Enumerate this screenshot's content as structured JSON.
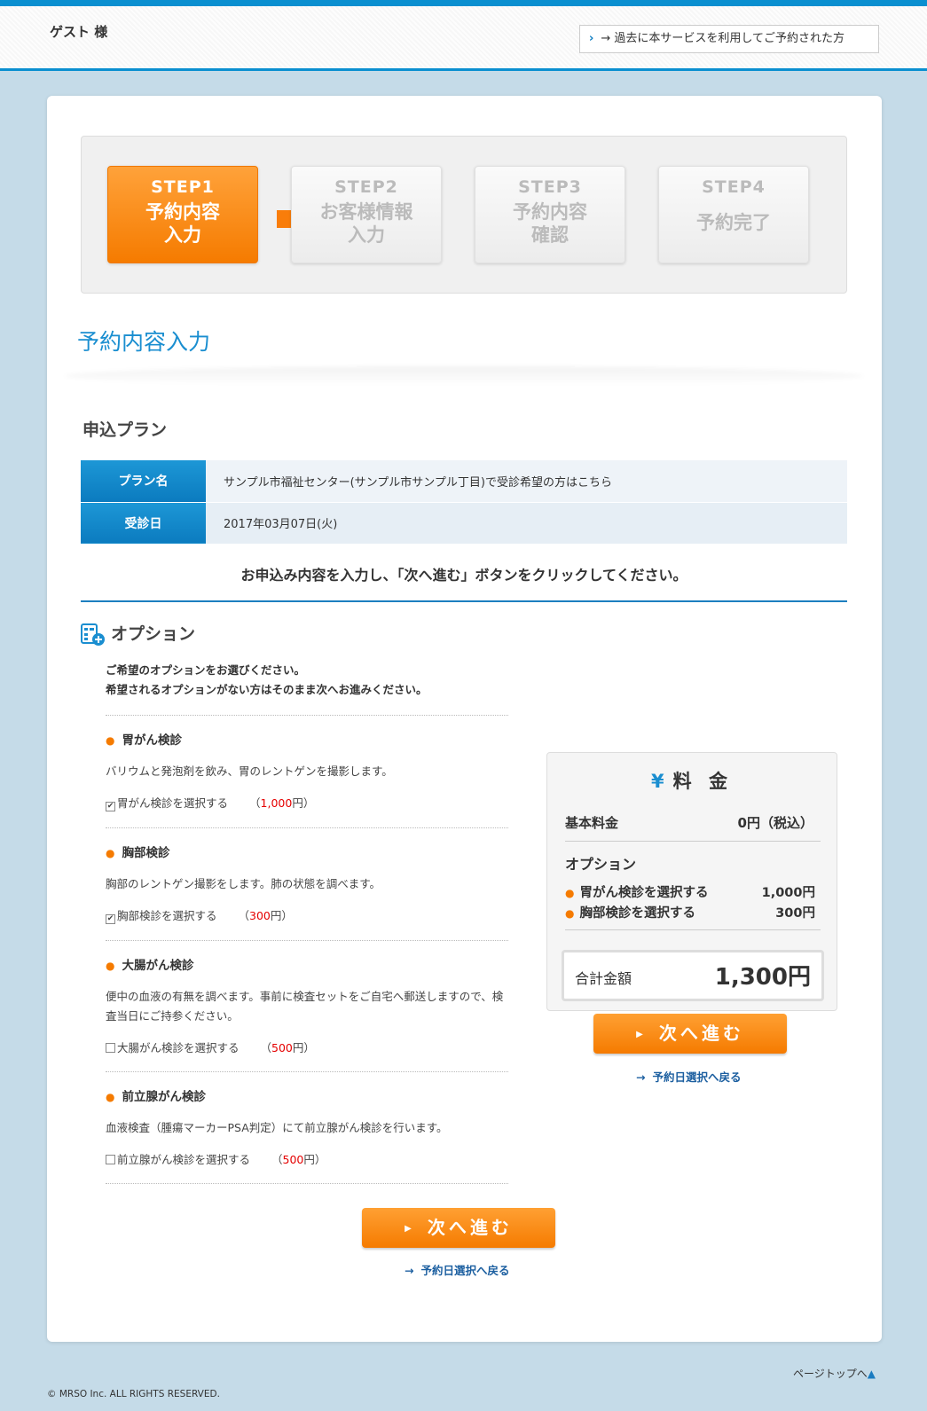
{
  "header": {
    "guest": "ゲスト 様",
    "past_link": "→ 過去に本サービスを利用してご予約された方"
  },
  "steps": [
    {
      "num": "STEP1",
      "label_1": "予約内容",
      "label_2": "入力"
    },
    {
      "num": "STEP2",
      "label_1": "お客様情報",
      "label_2": "入力"
    },
    {
      "num": "STEP3",
      "label_1": "予約内容",
      "label_2": "確認"
    },
    {
      "num": "STEP4",
      "label_1": "予約完了",
      "label_2": ""
    }
  ],
  "page_title": "予約内容入力",
  "plan": {
    "section_title": "申込プラン",
    "rows": [
      {
        "label": "プラン名",
        "value": "サンプル市福祉センター(サンプル市サンプル丁目)で受診希望の方はこちら"
      },
      {
        "label": "受診日",
        "value": "2017年03月07日(火)"
      }
    ]
  },
  "instruction": "お申込み内容を入力し、「次へ進む」ボタンをクリックしてください。",
  "options": {
    "title": "オプション",
    "desc_1": "ご希望のオプションをお選びください。",
    "desc_2": "希望されるオプションがない方はそのまま次へお進みください。",
    "items": [
      {
        "name": "胃がん検診",
        "text": "バリウムと発泡剤を飲み、胃のレントゲンを撮影します。",
        "check_label": "胃がん検診を選択する",
        "price_open": "（",
        "price": "1,000",
        "price_close": "円）",
        "checked": true
      },
      {
        "name": "胸部検診",
        "text": "胸部のレントゲン撮影をします。肺の状態を調べます。",
        "check_label": "胸部検診を選択する",
        "price_open": "（",
        "price": "300",
        "price_close": "円）",
        "checked": true
      },
      {
        "name": "大腸がん検診",
        "text": "便中の血液の有無を調べます。事前に検査セットをご自宅へ郵送しますので、検査当日にご持参ください。",
        "check_label": "大腸がん検診を選択する",
        "price_open": "（",
        "price": "500",
        "price_close": "円）",
        "checked": false
      },
      {
        "name": "前立腺がん検診",
        "text": "血液検査（腫瘍マーカーPSA判定）にて前立腺がん検診を行います。",
        "check_label": "前立腺がん検診を選択する",
        "price_open": "（",
        "price": "500",
        "price_close": "円）",
        "checked": false
      }
    ]
  },
  "fee": {
    "yen_icon": "¥",
    "title": "料 金",
    "base_label": "基本料金",
    "base_value": "0円（税込）",
    "options_label": "オプション",
    "items": [
      {
        "label": "胃がん検診を選択する",
        "value": "1,000円"
      },
      {
        "label": "胸部検診を選択する",
        "value": "300円"
      }
    ],
    "total_label": "合計金額",
    "total_value": "1,300円"
  },
  "buttons": {
    "next": "次へ進む",
    "back": "予約日選択へ戻る"
  },
  "footer": {
    "page_top": "ページトップへ",
    "copyright": "© MRSO Inc. ALL RIGHTS RESERVED."
  },
  "colors": {
    "accent_blue": "#0a8fd0",
    "accent_orange": "#f57b00",
    "price_red": "#e50000"
  }
}
